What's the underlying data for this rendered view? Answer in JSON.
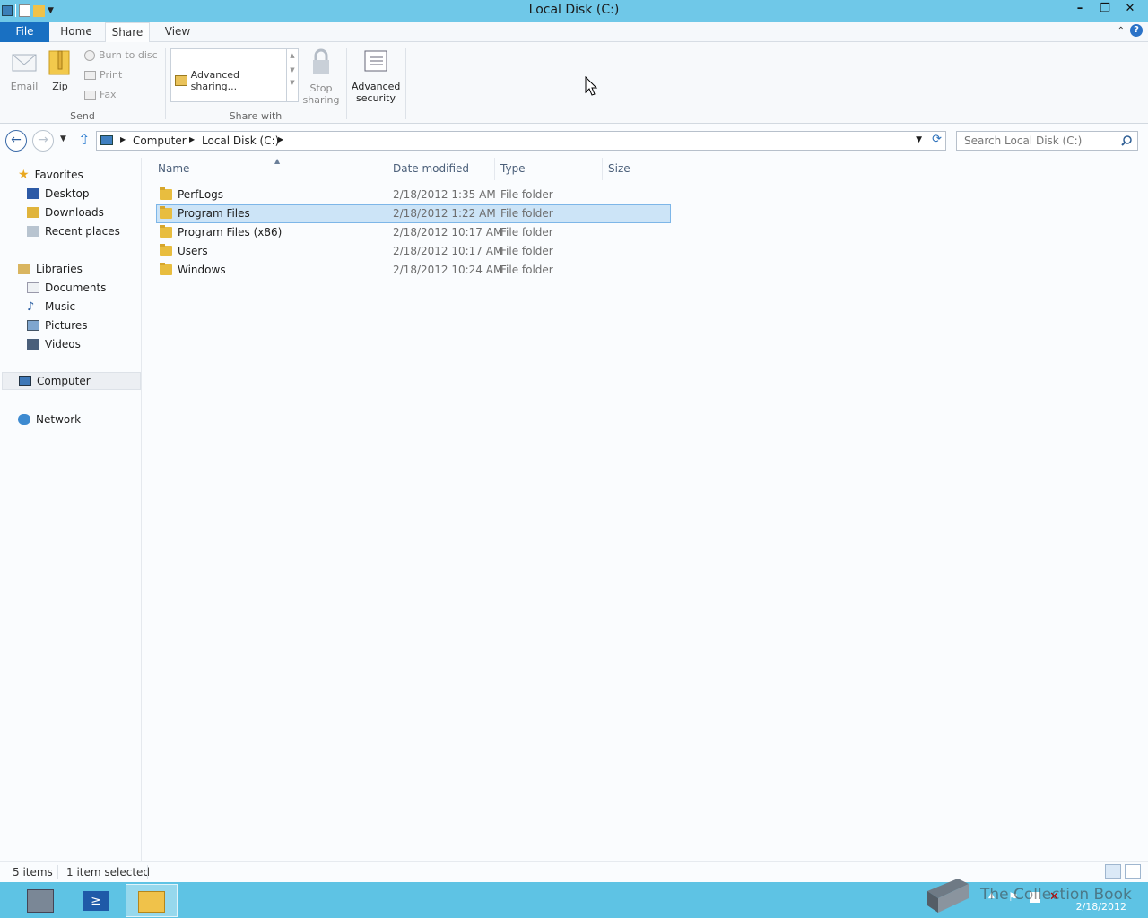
{
  "window": {
    "title": "Local Disk (C:)"
  },
  "tabs": {
    "file": "File",
    "home": "Home",
    "share": "Share",
    "view": "View"
  },
  "ribbon": {
    "send": {
      "label": "Send",
      "email": "Email",
      "zip": "Zip",
      "burn": "Burn to disc",
      "print": "Print",
      "fax": "Fax"
    },
    "share_with": {
      "label": "Share with",
      "advanced_sharing": "Advanced sharing...",
      "stop_sharing_line1": "Stop",
      "stop_sharing_line2": "sharing"
    },
    "advanced_security_line1": "Advanced",
    "advanced_security_line2": "security"
  },
  "address": {
    "crumbs": [
      "Computer",
      "Local Disk (C:)"
    ],
    "search_placeholder": "Search Local Disk (C:)"
  },
  "nav": {
    "favorites": "Favorites",
    "desktop": "Desktop",
    "downloads": "Downloads",
    "recent": "Recent places",
    "libraries": "Libraries",
    "documents": "Documents",
    "music": "Music",
    "pictures": "Pictures",
    "videos": "Videos",
    "computer": "Computer",
    "network": "Network"
  },
  "columns": {
    "name": "Name",
    "date": "Date modified",
    "type": "Type",
    "size": "Size"
  },
  "files": [
    {
      "name": "PerfLogs",
      "date": "2/18/2012 1:35 AM",
      "type": "File folder"
    },
    {
      "name": "Program Files",
      "date": "2/18/2012 1:22 AM",
      "type": "File folder"
    },
    {
      "name": "Program Files (x86)",
      "date": "2/18/2012 10:17 AM",
      "type": "File folder"
    },
    {
      "name": "Users",
      "date": "2/18/2012 10:17 AM",
      "type": "File folder"
    },
    {
      "name": "Windows",
      "date": "2/18/2012 10:24 AM",
      "type": "File folder"
    }
  ],
  "status": {
    "count": "5 items",
    "selected": "1 item selected"
  },
  "taskbar": {
    "date": "2/18/2012"
  },
  "watermark": "The Collection Book"
}
